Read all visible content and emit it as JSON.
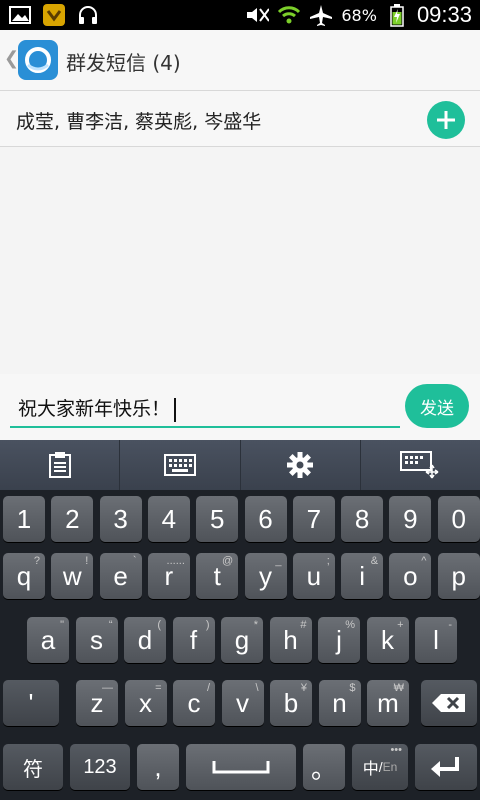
{
  "statusbar": {
    "battery_pct": "68%",
    "time": "09:33"
  },
  "header": {
    "title": "群发短信 (4)"
  },
  "recipients": {
    "text": "成莹, 曹李洁, 蔡英彪, 岑盛华"
  },
  "compose": {
    "text": "祝大家新年快乐！",
    "send_label": "发送"
  },
  "keyboard": {
    "digits": [
      "1",
      "2",
      "3",
      "4",
      "5",
      "6",
      "7",
      "8",
      "9",
      "0"
    ],
    "row1": [
      {
        "k": "q",
        "s": "?"
      },
      {
        "k": "w",
        "s": "!"
      },
      {
        "k": "e",
        "s": "`"
      },
      {
        "k": "r",
        "s": "......"
      },
      {
        "k": "t",
        "s": "@"
      },
      {
        "k": "y",
        "s": "_"
      },
      {
        "k": "u",
        "s": ";"
      },
      {
        "k": "i",
        "s": "&"
      },
      {
        "k": "o",
        "s": "^"
      },
      {
        "k": "p",
        "s": ""
      }
    ],
    "row2": [
      {
        "k": "a",
        "s": "\""
      },
      {
        "k": "s",
        "s": "“"
      },
      {
        "k": "d",
        "s": "("
      },
      {
        "k": "f",
        "s": ")"
      },
      {
        "k": "g",
        "s": "*"
      },
      {
        "k": "h",
        "s": "#"
      },
      {
        "k": "j",
        "s": "%"
      },
      {
        "k": "k",
        "s": "+"
      },
      {
        "k": "l",
        "s": "-"
      }
    ],
    "row3_left": "'",
    "row3": [
      {
        "k": "z",
        "s": "—"
      },
      {
        "k": "x",
        "s": "="
      },
      {
        "k": "c",
        "s": "/"
      },
      {
        "k": "v",
        "s": "\\"
      },
      {
        "k": "b",
        "s": "¥"
      },
      {
        "k": "n",
        "s": "$"
      },
      {
        "k": "m",
        "s": "₩"
      }
    ],
    "bottom": {
      "symbol": "符",
      "numeric": "123",
      "comma": ",",
      "period": "。",
      "lang_zh": "中",
      "lang_sep": "/",
      "lang_en": "En"
    }
  }
}
